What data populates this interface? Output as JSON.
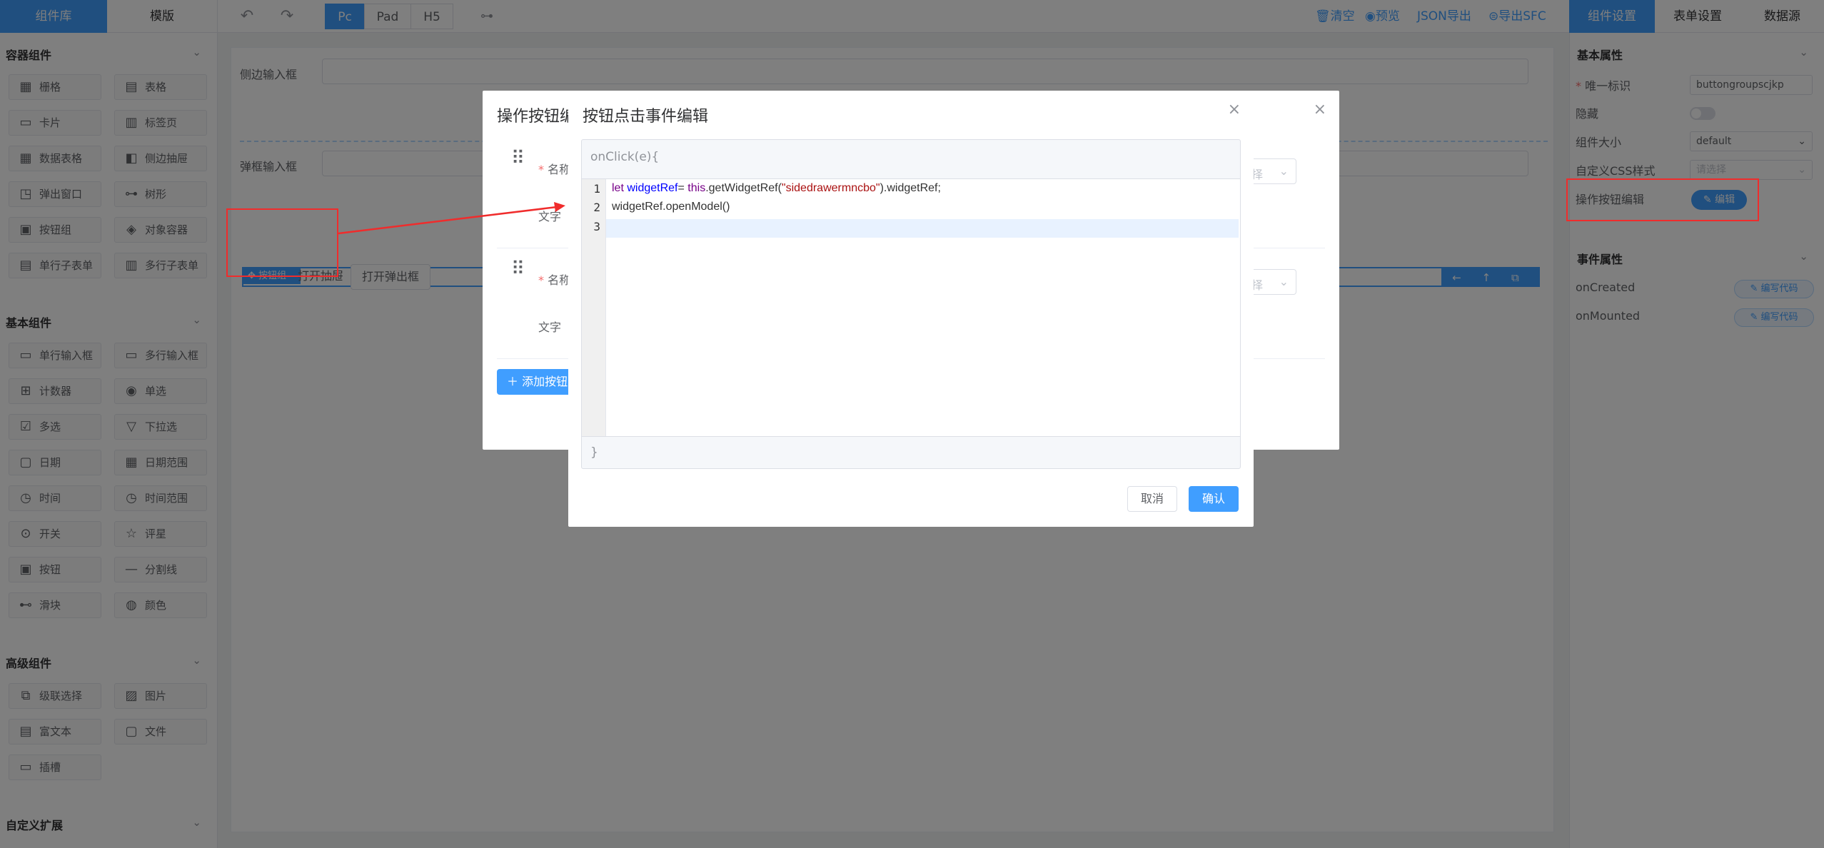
{
  "topbar": {
    "tab_library": "组件库",
    "tab_template": "模版",
    "undo_icon": "undo-icon",
    "redo_icon": "redo-icon",
    "devices": [
      "Pc",
      "Pad",
      "H5"
    ],
    "tree_icon": "tree-icon",
    "tools": [
      "清空",
      "预览",
      "JSON导出",
      "导出SFC"
    ],
    "right_tabs": [
      "组件设置",
      "表单设置",
      "数据源"
    ]
  },
  "sidebar": {
    "container_title": "容器组件",
    "container_items": [
      "栅格",
      "表格",
      "卡片",
      "标签页",
      "数据表格",
      "侧边抽屉",
      "弹出窗口",
      "树形",
      "按钮组",
      "对象容器",
      "单行子表单",
      "多行子表单"
    ],
    "basic_title": "基本组件",
    "basic_items": [
      "单行输入框",
      "多行输入框",
      "计数器",
      "单选",
      "多选",
      "下拉选",
      "日期",
      "日期范围",
      "时间",
      "时间范围",
      "开关",
      "评星",
      "按钮",
      "分割线",
      "滑块",
      "颜色"
    ],
    "advanced_title": "高级组件",
    "advanced_items": [
      "级联选择",
      "图片",
      "富文本",
      "文件",
      "插槽"
    ],
    "custom_title": "自定义扩展"
  },
  "canvas": {
    "row1_label": "侧边输入框",
    "row2_label": "弹框输入框",
    "btn_group_tag": "按钮组",
    "btn_drawer": "打开抽屉",
    "btn_dialog": "打开弹出框",
    "tools_icons": "← ↑ ⧉ 🗑"
  },
  "properties": {
    "basic_title": "基本属性",
    "unique_id_label": "唯一标识",
    "unique_id_value": "buttongroupscjkp",
    "hidden_label": "隐藏",
    "size_label": "组件大小",
    "size_value": "default",
    "css_label": "自定义CSS样式",
    "css_placeholder": "请选择",
    "action_label": "操作按钮编辑",
    "edit_button": "编辑",
    "event_title": "事件属性",
    "on_created": "onCreated",
    "on_mounted": "onMounted",
    "write_code": "编写代码"
  },
  "dialog1": {
    "title": "操作按钮编辑",
    "name_label": "名称",
    "text_label": "文字",
    "select_placeholder": "选择",
    "add_button": "添加按钮"
  },
  "dialog2": {
    "title": "按钮点击事件编辑",
    "header": "onClick(e){",
    "line_numbers": [
      "1",
      "2",
      "3"
    ],
    "code_l1_a": "let ",
    "code_l1_b": "widgetRef",
    "code_l1_c": "= ",
    "code_l1_d": "this",
    "code_l1_e": ".getWidgetRef(",
    "code_l1_f": "\"sidedrawermncbo\"",
    "code_l1_g": ").widgetRef;",
    "code_l2": "widgetRef.openModel()",
    "footer": "}",
    "cancel": "取消",
    "confirm": "确认"
  },
  "colors": {
    "primary": "#409eff",
    "annotation_red": "#f02c2c"
  }
}
